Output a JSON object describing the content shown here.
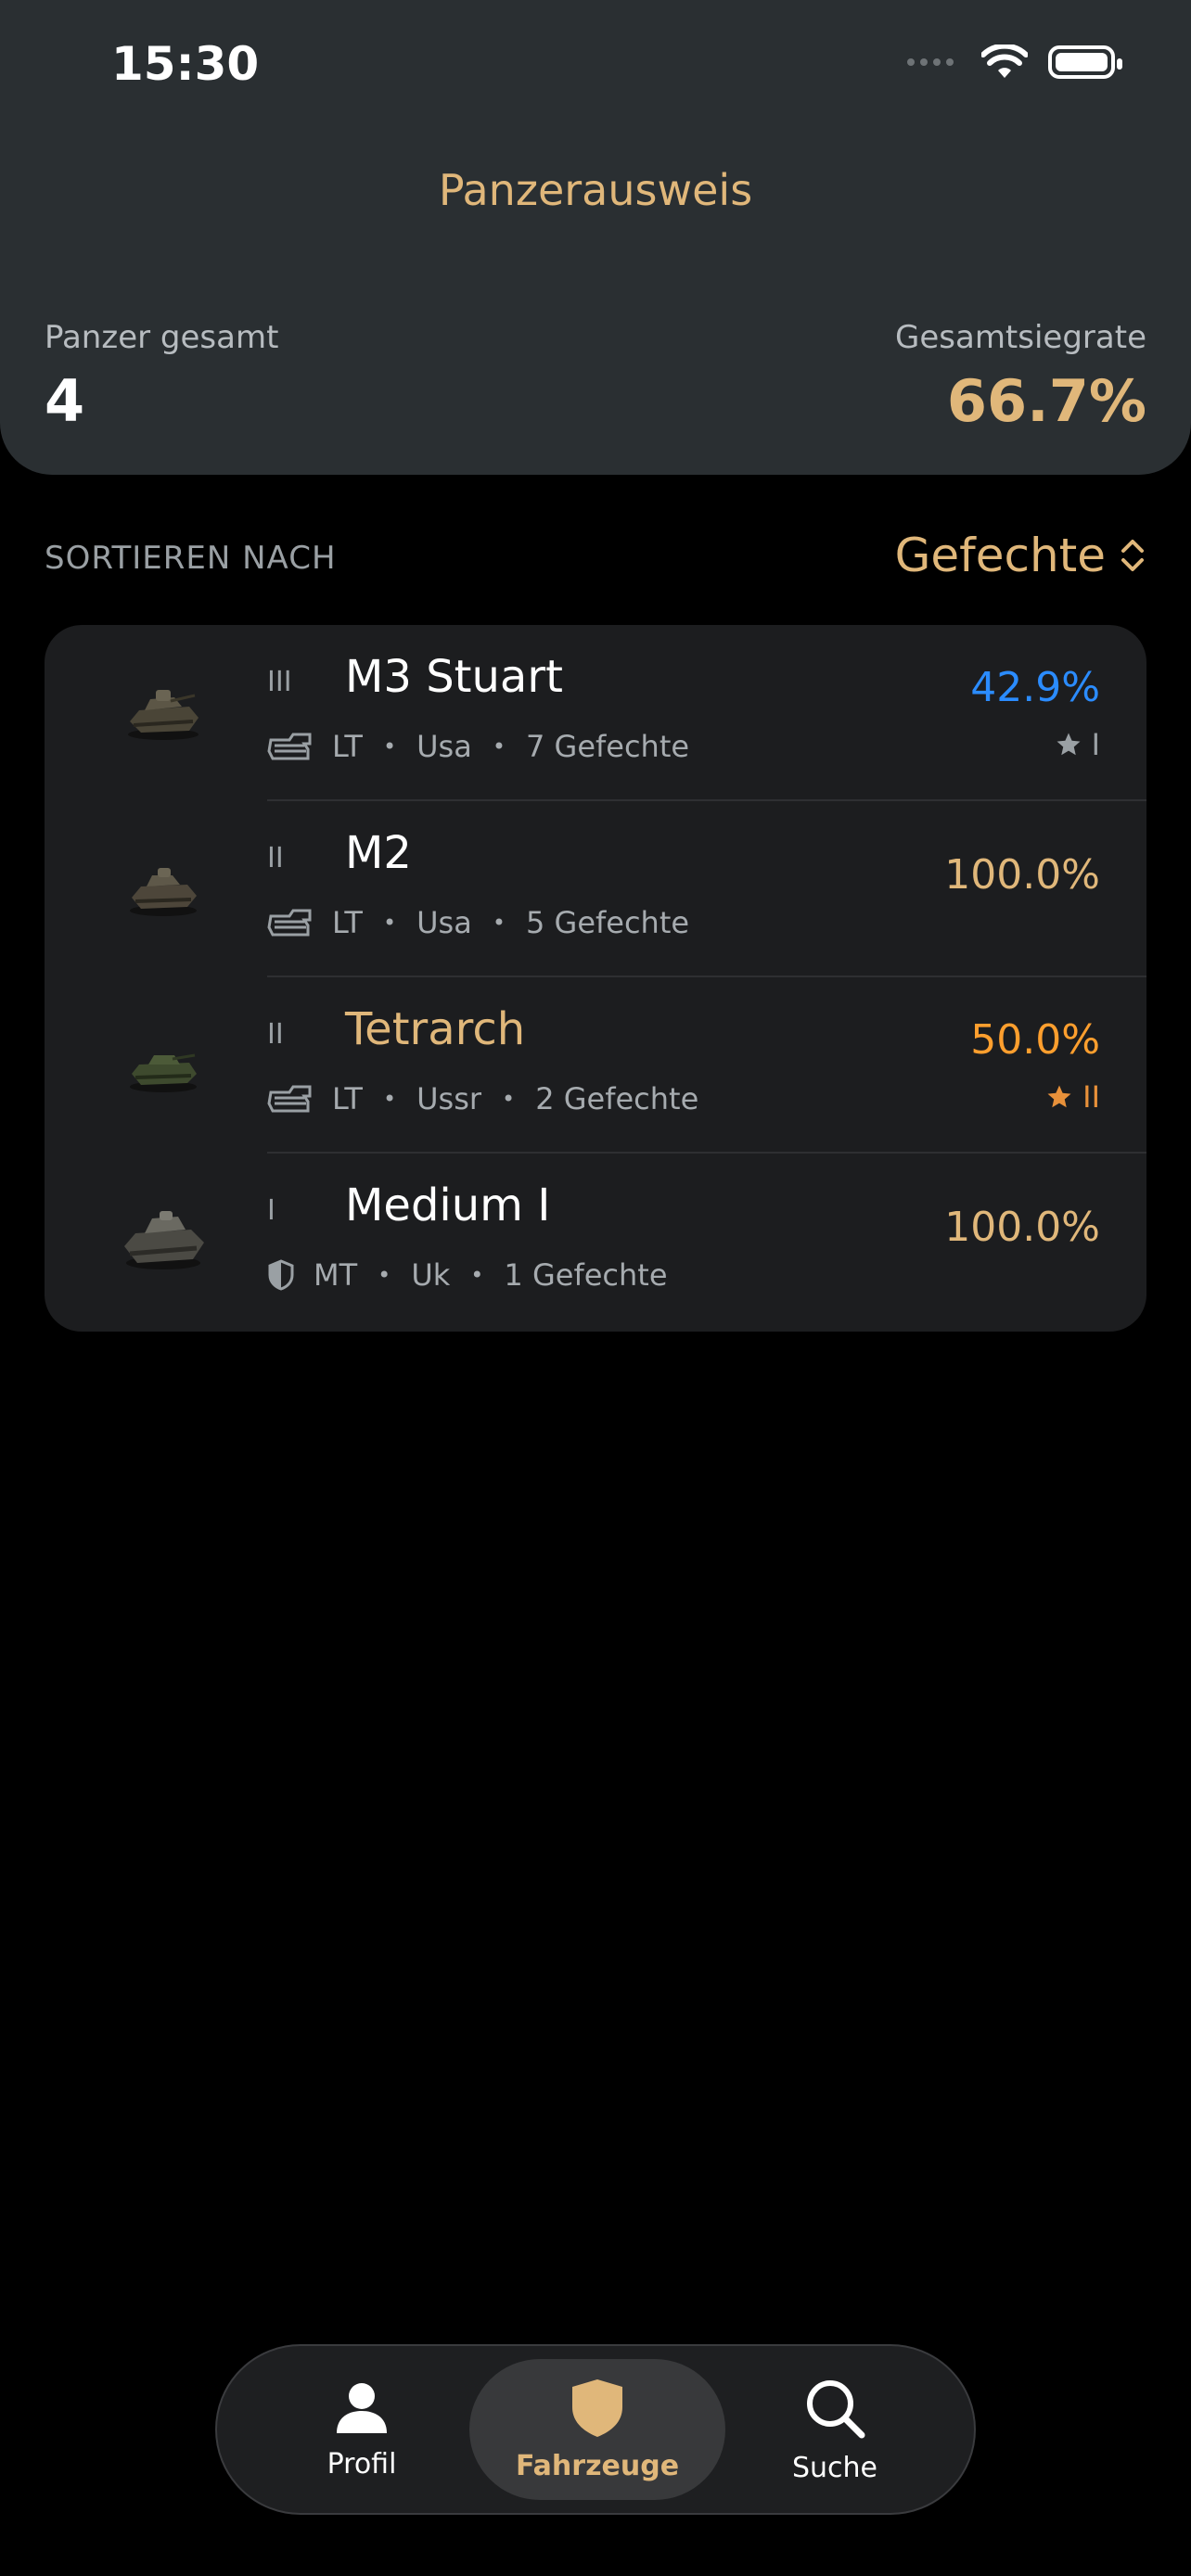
{
  "status_bar": {
    "time": "15:30"
  },
  "header": {
    "title": "Panzerausweis",
    "total_label": "Panzer gesamt",
    "total_value": "4",
    "winrate_label": "Gesamtsiegrate",
    "winrate_value": "66.7%"
  },
  "sort": {
    "label": "SORTIEREN NACH",
    "value": "Gefechte"
  },
  "tanks": [
    {
      "tier": "III",
      "name": "M3 Stuart",
      "type": "LT",
      "nation": "Usa",
      "battles": "7 Gefechte",
      "winrate": "42.9%",
      "mark": "I",
      "type_icon": "light-tank-icon"
    },
    {
      "tier": "II",
      "name": "M2",
      "type": "LT",
      "nation": "Usa",
      "battles": "5 Gefechte",
      "winrate": "100.0%",
      "mark": "",
      "type_icon": "light-tank-icon"
    },
    {
      "tier": "II",
      "name": "Tetrarch",
      "type": "LT",
      "nation": "Ussr",
      "battles": "2 Gefechte",
      "winrate": "50.0%",
      "mark": "II",
      "type_icon": "light-tank-icon"
    },
    {
      "tier": "I",
      "name": "Medium I",
      "type": "MT",
      "nation": "Uk",
      "battles": "1 Gefechte",
      "winrate": "100.0%",
      "mark": "",
      "type_icon": "medium-tank-icon"
    }
  ],
  "tabs": [
    {
      "label": "Profil",
      "icon": "person-icon"
    },
    {
      "label": "Fahrzeuge",
      "icon": "shield-icon",
      "active": true
    },
    {
      "label": "Suche",
      "icon": "search-icon"
    }
  ],
  "colors": {
    "accent_gold": "#e0b77a",
    "winrate_blue": "#2b8cff",
    "winrate_orange": "#ff9f2e"
  }
}
